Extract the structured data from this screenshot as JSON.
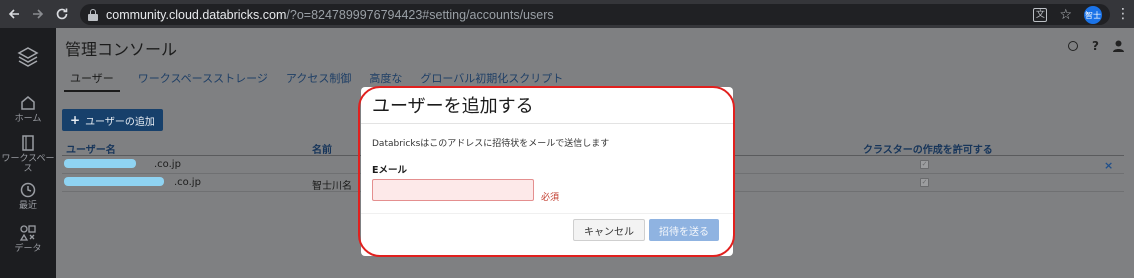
{
  "browser": {
    "url_host": "community.cloud.databricks.com",
    "url_rest": "/?o=8247899976794423#setting/accounts/users",
    "profile_initials": "智士",
    "back_icon": "arrow-left",
    "forward_icon": "arrow-right",
    "reload_icon": "reload",
    "star_glyph": "☆",
    "menu_glyph": "⋮"
  },
  "sidebar": {
    "items": [
      {
        "label": "ホーム",
        "icon": "home-icon"
      },
      {
        "label": "ワークスペース",
        "icon": "workspace-icon"
      },
      {
        "label": "最近",
        "icon": "clock-icon"
      },
      {
        "label": "データ",
        "icon": "data-icon"
      }
    ]
  },
  "header": {
    "title": "管理コンソール",
    "help_glyph": "?"
  },
  "tabs": [
    {
      "label": "ユーザー",
      "active": true
    },
    {
      "label": "ワークスペースストレージ",
      "active": false
    },
    {
      "label": "アクセス制御",
      "active": false
    },
    {
      "label": "高度な",
      "active": false
    },
    {
      "label": "グローバル初期化スクリプト",
      "active": false
    }
  ],
  "add_user_button": {
    "label": "ユーザーの追加",
    "glyph": "+"
  },
  "table": {
    "columns": [
      "ユーザー名",
      "名前",
      "クラスターの作成を許可する"
    ],
    "rows": [
      {
        "username_suffix": ".co.jp",
        "name": "",
        "cluster_check": "✓",
        "remove_glyph": "×"
      },
      {
        "username_suffix": ".co.jp",
        "name": "智士川名",
        "cluster_check": "✓",
        "remove_glyph": ""
      }
    ]
  },
  "modal": {
    "title": "ユーザーを追加する",
    "description": "Databricksはこのアドレスに招待状をメールで送信します",
    "email_label": "Eメール",
    "email_value": "",
    "required_text": "必須",
    "cancel_label": "キャンセル",
    "send_label": "招待を送る"
  },
  "colors": {
    "accent_blue": "#17406b",
    "highlight_outline": "#e1201e",
    "send_button": "#8fb3e1"
  }
}
